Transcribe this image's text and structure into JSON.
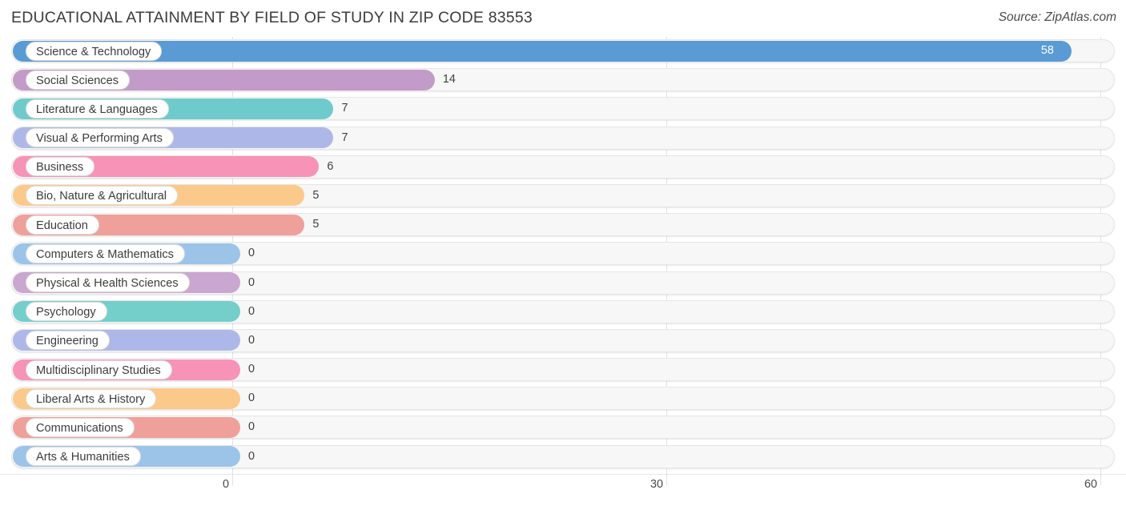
{
  "header": {
    "title": "EDUCATIONAL ATTAINMENT BY FIELD OF STUDY IN ZIP CODE 83553",
    "source": "Source: ZipAtlas.com"
  },
  "chart_data": {
    "type": "bar",
    "orientation": "horizontal",
    "title": "EDUCATIONAL ATTAINMENT BY FIELD OF STUDY IN ZIP CODE 83553",
    "subtitle": "",
    "xlabel": "",
    "ylabel": "",
    "xlim": [
      0,
      60
    ],
    "xticks": [
      0,
      30,
      60
    ],
    "xtick_labels": [
      "0",
      "30",
      "60"
    ],
    "grid": true,
    "legend": false,
    "categories": [
      "Science & Technology",
      "Social Sciences",
      "Literature & Languages",
      "Visual & Performing Arts",
      "Business",
      "Bio, Nature & Agricultural",
      "Education",
      "Computers & Mathematics",
      "Physical & Health Sciences",
      "Psychology",
      "Engineering",
      "Multidisciplinary Studies",
      "Liberal Arts & History",
      "Communications",
      "Arts & Humanities"
    ],
    "values": [
      58,
      14,
      7,
      7,
      6,
      5,
      5,
      0,
      0,
      0,
      0,
      0,
      0,
      0,
      0
    ],
    "value_labels": [
      "58",
      "14",
      "7",
      "7",
      "6",
      "5",
      "5",
      "0",
      "0",
      "0",
      "0",
      "0",
      "0",
      "0",
      "0"
    ],
    "colors": [
      "#5b9bd5",
      "#c39bc8",
      "#6fcbcb",
      "#aeb8e8",
      "#f793b6",
      "#fbc98a",
      "#efa09a",
      "#9bc4e8",
      "#c9a7d0",
      "#74cfcb",
      "#aeb8e8",
      "#f793b6",
      "#fbc98a",
      "#efa09a",
      "#9bc4e8"
    ]
  }
}
